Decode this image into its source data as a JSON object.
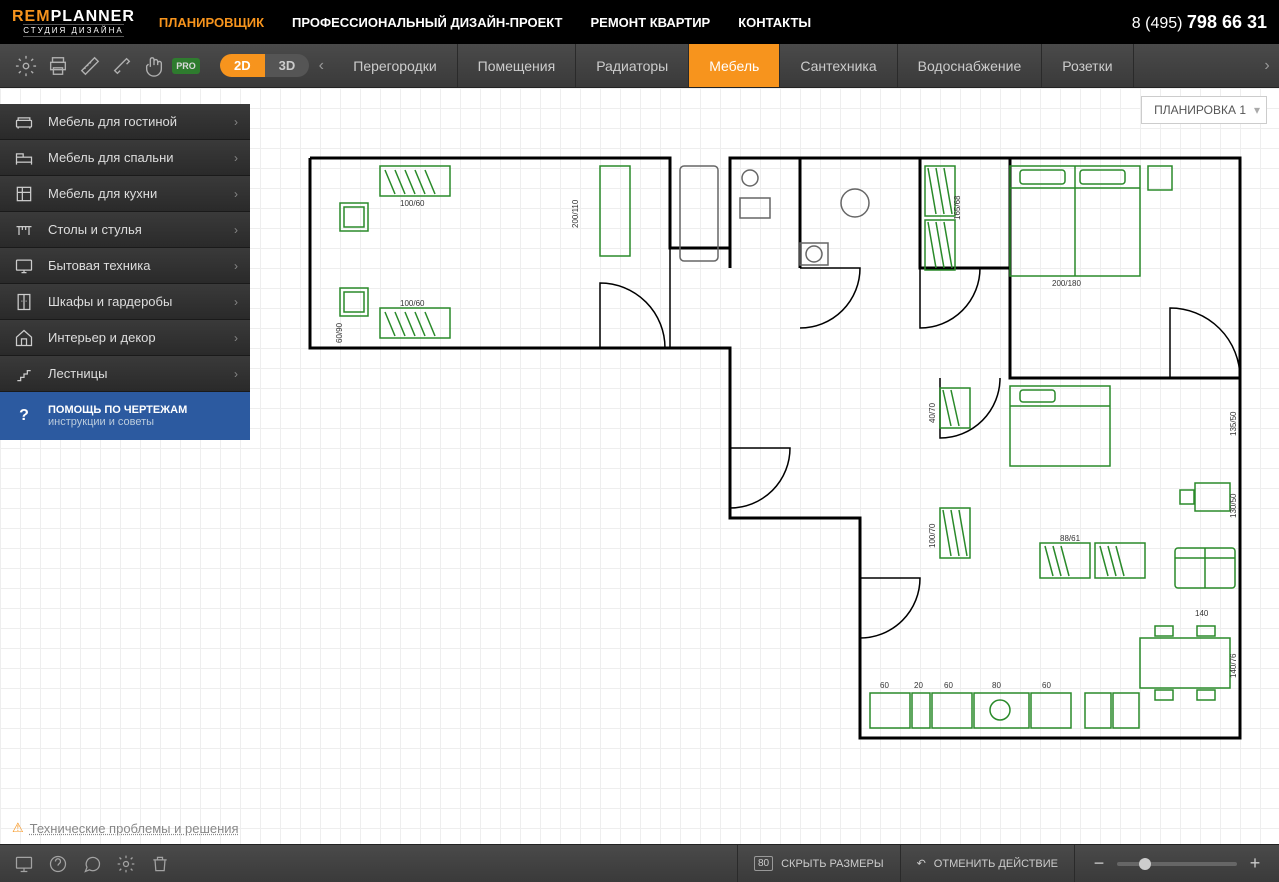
{
  "logo": {
    "part1": "REM",
    "part2": "PLANNER",
    "sub": "СТУДИЯ ДИЗАЙНА"
  },
  "nav": [
    "ПЛАНИРОВЩИК",
    "ПРОФЕССИОНАЛЬНЫЙ ДИЗАЙН-ПРОЕКТ",
    "РЕМОНТ КВАРТИР",
    "КОНТАКТЫ"
  ],
  "phone": {
    "prefix": "8 (495) ",
    "main": "798 66 31"
  },
  "view": {
    "d2": "2D",
    "d3": "3D"
  },
  "tabs": [
    "Перегородки",
    "Помещения",
    "Радиаторы",
    "Мебель",
    "Сантехника",
    "Водоснабжение",
    "Розетки"
  ],
  "sidebar": [
    "Мебель для гостиной",
    "Мебель для спальни",
    "Мебель для кухни",
    "Столы и стулья",
    "Бытовая техника",
    "Шкафы и гардеробы",
    "Интерьер и декор",
    "Лестницы"
  ],
  "help": {
    "title": "ПОМОЩЬ ПО ЧЕРТЕЖАМ",
    "sub": "инструкции и советы"
  },
  "plan_dropdown": "ПЛАНИРОВКА 1",
  "tech_link": "Технические проблемы и решения",
  "bottom": {
    "hide_sizes": "СКРЫТЬ РАЗМЕРЫ",
    "undo": "ОТМЕНИТЬ ДЕЙСТВИЕ"
  },
  "dims": {
    "d1": "100/60",
    "d2": "200/110",
    "d3": "100/60",
    "d4": "60/90",
    "d5": "165/68",
    "d6": "200/180",
    "d7": "40/70",
    "d8": "100/70",
    "d9": "135/50",
    "d10": "130/50",
    "d11": "88/61",
    "d12": "140",
    "d13": "60",
    "d14": "20",
    "d15": "60",
    "d16": "80",
    "d17": "60",
    "d18": "140/76"
  }
}
